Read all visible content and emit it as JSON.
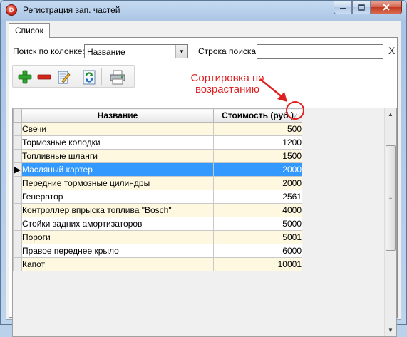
{
  "window": {
    "title": "Регистрация зап. частей",
    "app_icon_letter": "D"
  },
  "tabs": [
    {
      "label": "Список",
      "active": true
    }
  ],
  "search": {
    "column_label": "Поиск по колонке:",
    "column_value": "Название",
    "string_label": "Строка поиска:",
    "string_value": "",
    "clear_glyph": "X"
  },
  "toolbar": {
    "buttons": [
      "add-icon",
      "delete-icon",
      "edit-icon",
      "refresh-icon",
      "print-icon"
    ]
  },
  "annotation": {
    "text": "Сортировка по возрастанию",
    "color": "#e02020"
  },
  "grid": {
    "columns": [
      "Название",
      "Стоимость (руб.)"
    ],
    "sort": "ascending",
    "selected_row": 3,
    "rows": [
      {
        "name": "Свечи",
        "cost": "500"
      },
      {
        "name": "Тормозные колодки",
        "cost": "1200"
      },
      {
        "name": "Топливные шланги",
        "cost": "1500"
      },
      {
        "name": "Масляный картер",
        "cost": "2000"
      },
      {
        "name": "Передние тормозные цилиндры",
        "cost": "2000"
      },
      {
        "name": "Генератор",
        "cost": "2561"
      },
      {
        "name": "Контроллер впрыска топлива \"Bosch\"",
        "cost": "4000"
      },
      {
        "name": "Стойки задних амортизаторов",
        "cost": "5000"
      },
      {
        "name": "Пороги",
        "cost": "5001"
      },
      {
        "name": "Правое переднее крыло",
        "cost": "6000"
      },
      {
        "name": "Капот",
        "cost": "10001"
      }
    ]
  },
  "colors": {
    "row_stripe": "#fdf8df",
    "selection": "#3399ff",
    "accent_red": "#e02020"
  }
}
